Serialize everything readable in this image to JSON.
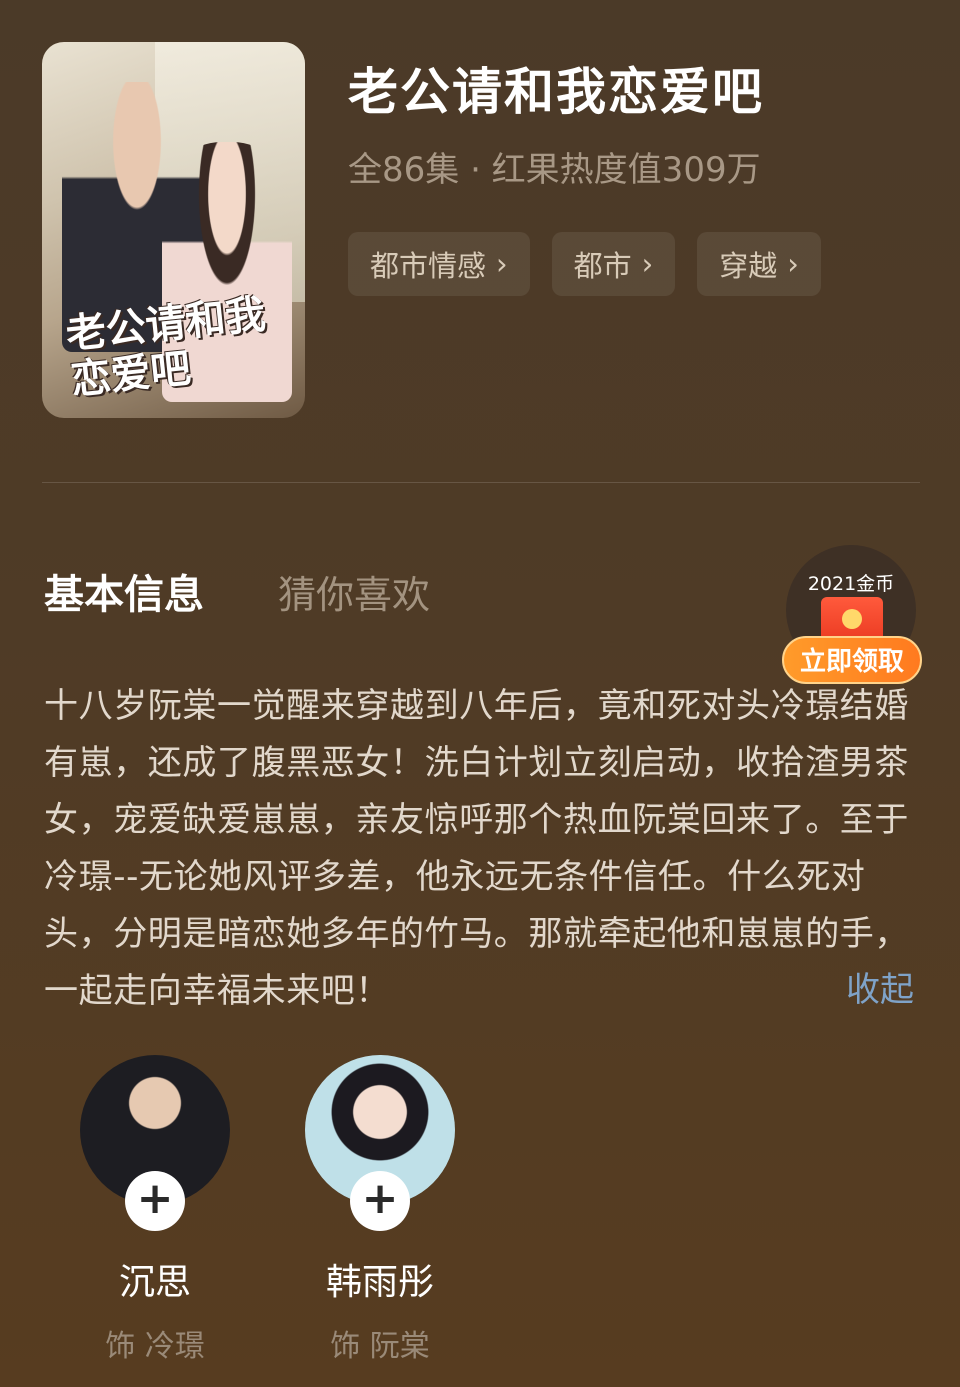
{
  "drama": {
    "title": "老公请和我恋爱吧",
    "meta": "全86集 · 红果热度值309万",
    "poster_title": "老公请和我恋爱吧",
    "tags": [
      "都市情感",
      "都市",
      "穿越"
    ]
  },
  "tabs": {
    "basic_info": "基本信息",
    "recommend": "猜你喜欢"
  },
  "reward": {
    "coins": "2021金币",
    "claim_label": "立即领取"
  },
  "synopsis": {
    "text": "十八岁阮棠一觉醒来穿越到八年后，竟和死对头冷璟结婚有崽，还成了腹黑恶女！洗白计划立刻启动，收拾渣男茶女，宠爱缺爱崽崽，亲友惊呼那个热血阮棠回来了。至于冷璟--无论她风评多差，他永远无条件信任。什么死对头，分明是暗恋她多年的竹马。那就牵起他和崽崽的手，一起走向幸福未来吧！",
    "collapse_label": "收起"
  },
  "cast": [
    {
      "name": "沉思",
      "role": "饰 冷璟"
    },
    {
      "name": "韩雨彤",
      "role": "饰 阮棠"
    }
  ],
  "icons": {
    "tag_arrow": "chevron-right-icon",
    "follow": "plus-icon",
    "envelope": "red-envelope-icon"
  }
}
